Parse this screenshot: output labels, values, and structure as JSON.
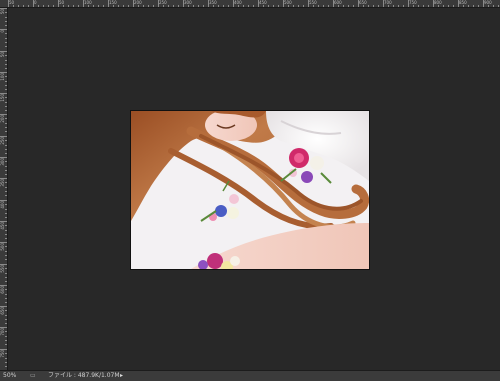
{
  "ruler": {
    "top_labels": [
      "50",
      "0",
      "50",
      "100",
      "150",
      "200",
      "250",
      "300",
      "350",
      "400",
      "450",
      "500",
      "550",
      "600",
      "650",
      "700",
      "750",
      "800",
      "850",
      "900"
    ],
    "left_labels": [
      "50",
      "0",
      "50",
      "100",
      "150",
      "200",
      "250",
      "300",
      "350",
      "400",
      "450",
      "500",
      "550",
      "600",
      "650",
      "700",
      "750"
    ]
  },
  "canvas": {
    "description_icon": "photo-of-woman-with-flowers"
  },
  "statusbar": {
    "zoom": "50%",
    "doc_info": "ファイル : 487.9K/1.07M",
    "arrow": "▸"
  },
  "colors": {
    "workspace": "#282828",
    "ruler": "#3a3a3a",
    "statusbar": "#3b3b3b"
  }
}
